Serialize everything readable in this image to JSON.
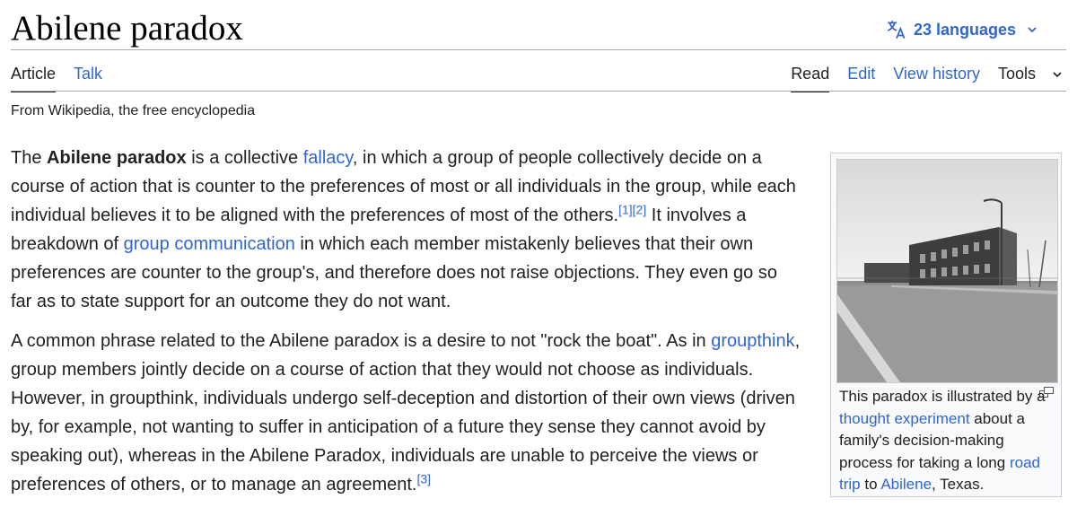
{
  "page": {
    "title": "Abilene paradox",
    "languages_label": "23 languages",
    "tagline": "From Wikipedia, the free encyclopedia"
  },
  "tabs": {
    "left": [
      "Article",
      "Talk"
    ],
    "right": [
      "Read",
      "Edit",
      "View history",
      "Tools"
    ]
  },
  "paragraph1": {
    "t1": "The ",
    "bold": "Abilene paradox",
    "t2": " is a collective ",
    "link_fallacy": "fallacy",
    "t3": ", in which a group of people collectively decide on a course of action that is counter to the preferences of most or all individuals in the group, while each individual believes it to be aligned with the preferences of most of the others.",
    "ref1": "[1]",
    "ref2": "[2]",
    "t4": " It involves a breakdown of ",
    "link_group_comm": "group communication",
    "t5": " in which each member mistakenly believes that their own preferences are counter to the group's, and therefore does not raise objections. They even go so far as to state support for an outcome they do not want."
  },
  "paragraph2": {
    "t1": "A common phrase related to the Abilene paradox is a desire to not \"rock the boat\". As in ",
    "link_groupthink": "groupthink",
    "t2": ", group members jointly decide on a course of action that they would not choose as individuals. However, in groupthink, individuals undergo self-deception and distortion of their own views (driven by, for example, not wanting to suffer in anticipation of a future they sense they cannot avoid by speaking out), whereas in the Abilene Paradox, individuals are unable to perceive the views or preferences of others, or to manage an agreement.",
    "ref3": "[3]"
  },
  "infobox": {
    "cap1": "This paradox is illustrated by a ",
    "link_thought": "thought experiment",
    "cap2": " about a family's decision-making process for taking a long ",
    "link_road_trip": "road trip",
    "cap3": " to ",
    "link_abilene": "Abilene",
    "cap4": ", Texas."
  },
  "colors": {
    "link": "#3366cc",
    "text": "#202122"
  }
}
